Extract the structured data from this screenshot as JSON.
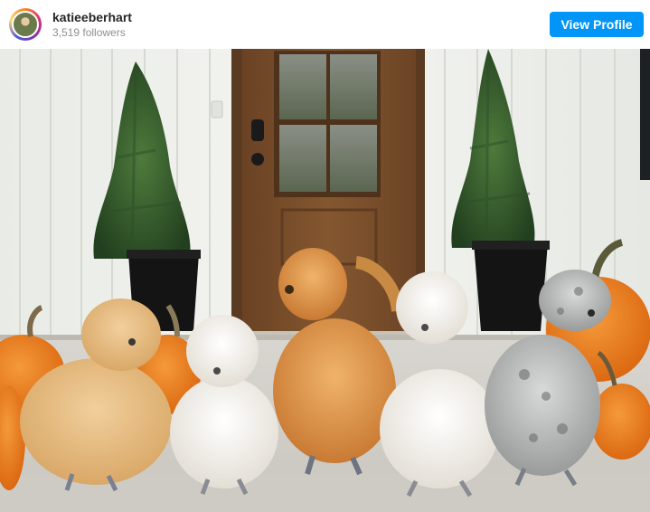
{
  "profile": {
    "username": "katieeberhart",
    "followers": "3,519 followers",
    "avatar_icon": "profile-avatar"
  },
  "actions": {
    "view_profile_label": "View Profile"
  },
  "colors": {
    "accent": "#0095f6",
    "siding": "#f1f2ee",
    "door": "#7a4f2c",
    "pumpkin": "#e8781c"
  },
  "photo": {
    "subject_icons": [
      "siding-wall",
      "wood-door",
      "topiary-tree",
      "black-planter",
      "pumpkin",
      "silkie-chicken"
    ]
  }
}
